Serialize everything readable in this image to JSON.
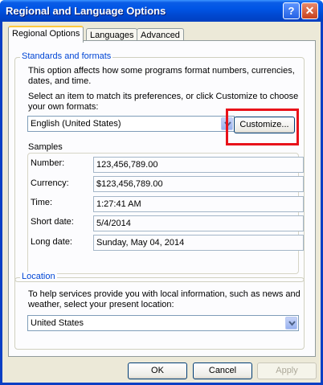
{
  "window": {
    "title": "Regional and Language Options",
    "help_glyph": "?",
    "close_glyph": "✕"
  },
  "tabs": [
    {
      "label": "Regional Options",
      "active": true
    },
    {
      "label": "Languages",
      "active": false
    },
    {
      "label": "Advanced",
      "active": false
    }
  ],
  "standards": {
    "legend": "Standards and formats",
    "description_line1": "This option affects how some programs format numbers, currencies,",
    "description_line2": "dates, and time.",
    "select_line1": "Select an item to match its preferences, or click Customize to choose",
    "select_line2": "your own formats:",
    "format_value": "English (United States)",
    "customize_label": "Customize...",
    "samples_label": "Samples",
    "samples": [
      {
        "label": "Number:",
        "value": "123,456,789.00"
      },
      {
        "label": "Currency:",
        "value": "$123,456,789.00"
      },
      {
        "label": "Time:",
        "value": "1:27:41 AM"
      },
      {
        "label": "Short date:",
        "value": "5/4/2014"
      },
      {
        "label": "Long date:",
        "value": "Sunday, May 04, 2014"
      }
    ]
  },
  "location": {
    "legend": "Location",
    "description_line1": "To help services provide you with local information, such as news and",
    "description_line2": "weather, select your present location:",
    "value": "United States"
  },
  "footer": {
    "ok_label": "OK",
    "cancel_label": "Cancel",
    "apply_label": "Apply"
  },
  "colors": {
    "highlight": "#e8121a",
    "title_bar": "#0055e5",
    "legend_text": "#0046d5"
  }
}
